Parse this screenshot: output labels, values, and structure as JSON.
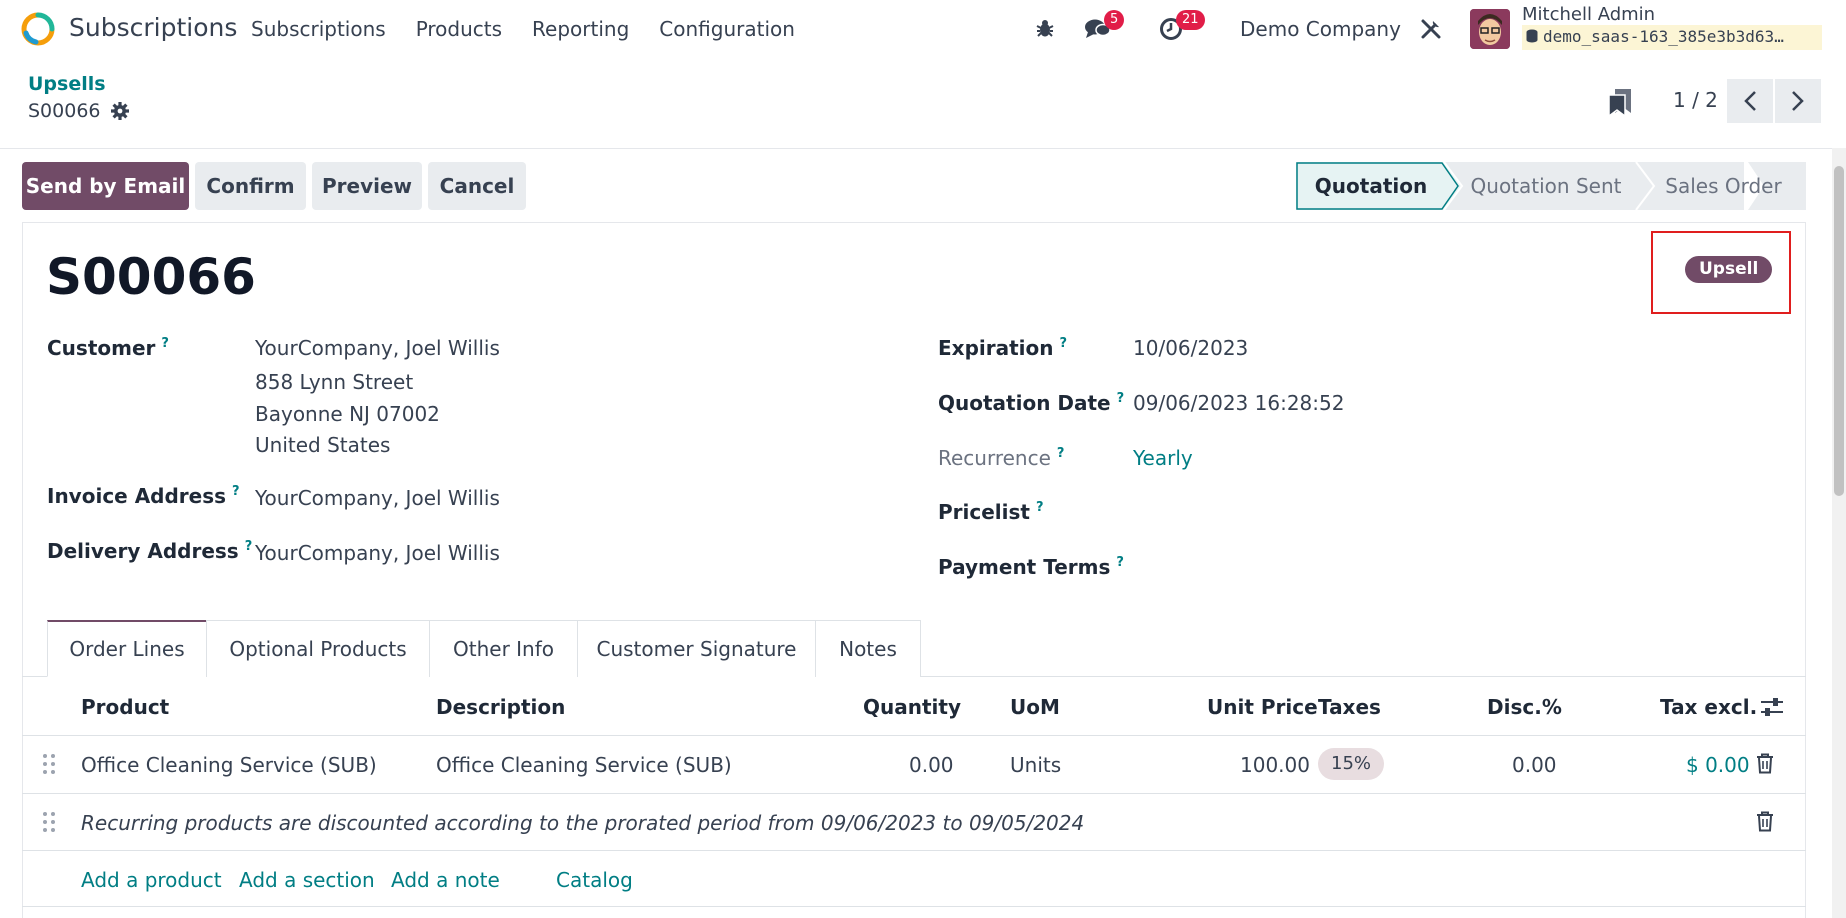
{
  "navbar": {
    "app_title": "Subscriptions",
    "menu": [
      "Subscriptions",
      "Products",
      "Reporting",
      "Configuration"
    ],
    "messages_count": "5",
    "activities_count": "21",
    "company": "Demo Company",
    "user_name": "Mitchell Admin",
    "database": "demo_saas-163_385e3b3d63…"
  },
  "control_panel": {
    "breadcrumb": "Upsells",
    "record_name": "S00066",
    "pager": "1 / 2"
  },
  "actions": {
    "send_email": "Send by Email",
    "confirm": "Confirm",
    "preview": "Preview",
    "cancel": "Cancel"
  },
  "status": {
    "stages": [
      "Quotation",
      "Quotation Sent",
      "Sales Order"
    ],
    "current": "Quotation"
  },
  "form": {
    "title": "S00066",
    "tag": "Upsell",
    "customer_label": "Customer",
    "customer_lines": [
      "YourCompany, Joel Willis",
      "858 Lynn Street",
      "Bayonne NJ 07002",
      "United States"
    ],
    "invoice_label": "Invoice Address",
    "invoice_value": "YourCompany, Joel Willis",
    "delivery_label": "Delivery Address",
    "delivery_value": "YourCompany, Joel Willis",
    "expiration_label": "Expiration",
    "expiration_value": "10/06/2023",
    "quotation_date_label": "Quotation Date",
    "quotation_date_value": "09/06/2023 16:28:52",
    "recurrence_label": "Recurrence",
    "recurrence_value": "Yearly",
    "pricelist_label": "Pricelist",
    "payment_terms_label": "Payment Terms",
    "help_mark": "?"
  },
  "tabs": [
    "Order Lines",
    "Optional Products",
    "Other Info",
    "Customer Signature",
    "Notes"
  ],
  "order_lines": {
    "columns": [
      "Product",
      "Description",
      "Quantity",
      "UoM",
      "Unit Price",
      "Taxes",
      "Disc.%",
      "Tax excl."
    ],
    "rows": [
      {
        "product": "Office Cleaning Service (SUB)",
        "description": "Office Cleaning Service (SUB)",
        "quantity": "0.00",
        "uom": "Units",
        "unit_price": "100.00",
        "taxes": "15%",
        "discount": "0.00",
        "subtotal": "$ 0.00"
      }
    ],
    "note": "Recurring products are discounted according to the prorated period from 09/06/2023 to 09/05/2024",
    "add_product": "Add a product",
    "add_section": "Add a section",
    "add_note": "Add a note",
    "catalog": "Catalog"
  },
  "colors": {
    "brand": "#714b67",
    "link": "#017e84",
    "badge": "#e11d48",
    "highlight": "#e01e1e"
  }
}
